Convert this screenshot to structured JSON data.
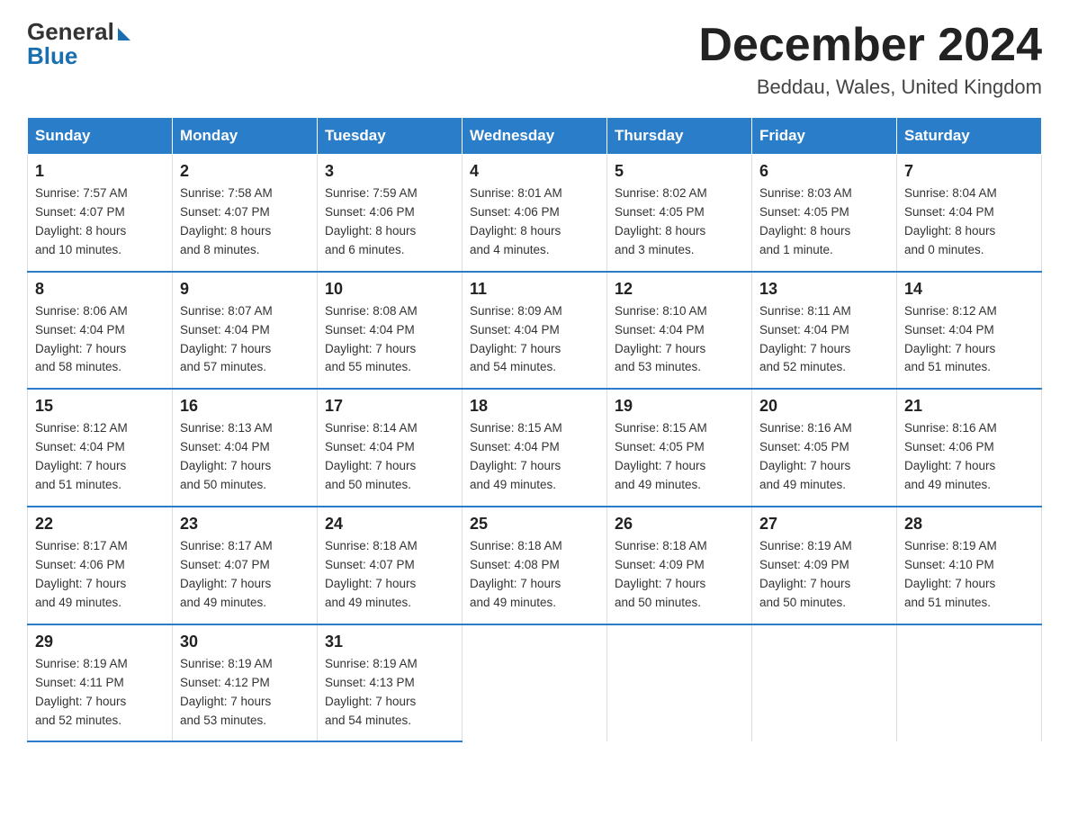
{
  "header": {
    "logo_general": "General",
    "logo_blue": "Blue",
    "month_title": "December 2024",
    "location": "Beddau, Wales, United Kingdom"
  },
  "weekdays": [
    "Sunday",
    "Monday",
    "Tuesday",
    "Wednesday",
    "Thursday",
    "Friday",
    "Saturday"
  ],
  "weeks": [
    [
      {
        "day": "1",
        "info": "Sunrise: 7:57 AM\nSunset: 4:07 PM\nDaylight: 8 hours\nand 10 minutes."
      },
      {
        "day": "2",
        "info": "Sunrise: 7:58 AM\nSunset: 4:07 PM\nDaylight: 8 hours\nand 8 minutes."
      },
      {
        "day": "3",
        "info": "Sunrise: 7:59 AM\nSunset: 4:06 PM\nDaylight: 8 hours\nand 6 minutes."
      },
      {
        "day": "4",
        "info": "Sunrise: 8:01 AM\nSunset: 4:06 PM\nDaylight: 8 hours\nand 4 minutes."
      },
      {
        "day": "5",
        "info": "Sunrise: 8:02 AM\nSunset: 4:05 PM\nDaylight: 8 hours\nand 3 minutes."
      },
      {
        "day": "6",
        "info": "Sunrise: 8:03 AM\nSunset: 4:05 PM\nDaylight: 8 hours\nand 1 minute."
      },
      {
        "day": "7",
        "info": "Sunrise: 8:04 AM\nSunset: 4:04 PM\nDaylight: 8 hours\nand 0 minutes."
      }
    ],
    [
      {
        "day": "8",
        "info": "Sunrise: 8:06 AM\nSunset: 4:04 PM\nDaylight: 7 hours\nand 58 minutes."
      },
      {
        "day": "9",
        "info": "Sunrise: 8:07 AM\nSunset: 4:04 PM\nDaylight: 7 hours\nand 57 minutes."
      },
      {
        "day": "10",
        "info": "Sunrise: 8:08 AM\nSunset: 4:04 PM\nDaylight: 7 hours\nand 55 minutes."
      },
      {
        "day": "11",
        "info": "Sunrise: 8:09 AM\nSunset: 4:04 PM\nDaylight: 7 hours\nand 54 minutes."
      },
      {
        "day": "12",
        "info": "Sunrise: 8:10 AM\nSunset: 4:04 PM\nDaylight: 7 hours\nand 53 minutes."
      },
      {
        "day": "13",
        "info": "Sunrise: 8:11 AM\nSunset: 4:04 PM\nDaylight: 7 hours\nand 52 minutes."
      },
      {
        "day": "14",
        "info": "Sunrise: 8:12 AM\nSunset: 4:04 PM\nDaylight: 7 hours\nand 51 minutes."
      }
    ],
    [
      {
        "day": "15",
        "info": "Sunrise: 8:12 AM\nSunset: 4:04 PM\nDaylight: 7 hours\nand 51 minutes."
      },
      {
        "day": "16",
        "info": "Sunrise: 8:13 AM\nSunset: 4:04 PM\nDaylight: 7 hours\nand 50 minutes."
      },
      {
        "day": "17",
        "info": "Sunrise: 8:14 AM\nSunset: 4:04 PM\nDaylight: 7 hours\nand 50 minutes."
      },
      {
        "day": "18",
        "info": "Sunrise: 8:15 AM\nSunset: 4:04 PM\nDaylight: 7 hours\nand 49 minutes."
      },
      {
        "day": "19",
        "info": "Sunrise: 8:15 AM\nSunset: 4:05 PM\nDaylight: 7 hours\nand 49 minutes."
      },
      {
        "day": "20",
        "info": "Sunrise: 8:16 AM\nSunset: 4:05 PM\nDaylight: 7 hours\nand 49 minutes."
      },
      {
        "day": "21",
        "info": "Sunrise: 8:16 AM\nSunset: 4:06 PM\nDaylight: 7 hours\nand 49 minutes."
      }
    ],
    [
      {
        "day": "22",
        "info": "Sunrise: 8:17 AM\nSunset: 4:06 PM\nDaylight: 7 hours\nand 49 minutes."
      },
      {
        "day": "23",
        "info": "Sunrise: 8:17 AM\nSunset: 4:07 PM\nDaylight: 7 hours\nand 49 minutes."
      },
      {
        "day": "24",
        "info": "Sunrise: 8:18 AM\nSunset: 4:07 PM\nDaylight: 7 hours\nand 49 minutes."
      },
      {
        "day": "25",
        "info": "Sunrise: 8:18 AM\nSunset: 4:08 PM\nDaylight: 7 hours\nand 49 minutes."
      },
      {
        "day": "26",
        "info": "Sunrise: 8:18 AM\nSunset: 4:09 PM\nDaylight: 7 hours\nand 50 minutes."
      },
      {
        "day": "27",
        "info": "Sunrise: 8:19 AM\nSunset: 4:09 PM\nDaylight: 7 hours\nand 50 minutes."
      },
      {
        "day": "28",
        "info": "Sunrise: 8:19 AM\nSunset: 4:10 PM\nDaylight: 7 hours\nand 51 minutes."
      }
    ],
    [
      {
        "day": "29",
        "info": "Sunrise: 8:19 AM\nSunset: 4:11 PM\nDaylight: 7 hours\nand 52 minutes."
      },
      {
        "day": "30",
        "info": "Sunrise: 8:19 AM\nSunset: 4:12 PM\nDaylight: 7 hours\nand 53 minutes."
      },
      {
        "day": "31",
        "info": "Sunrise: 8:19 AM\nSunset: 4:13 PM\nDaylight: 7 hours\nand 54 minutes."
      },
      {
        "day": "",
        "info": ""
      },
      {
        "day": "",
        "info": ""
      },
      {
        "day": "",
        "info": ""
      },
      {
        "day": "",
        "info": ""
      }
    ]
  ]
}
